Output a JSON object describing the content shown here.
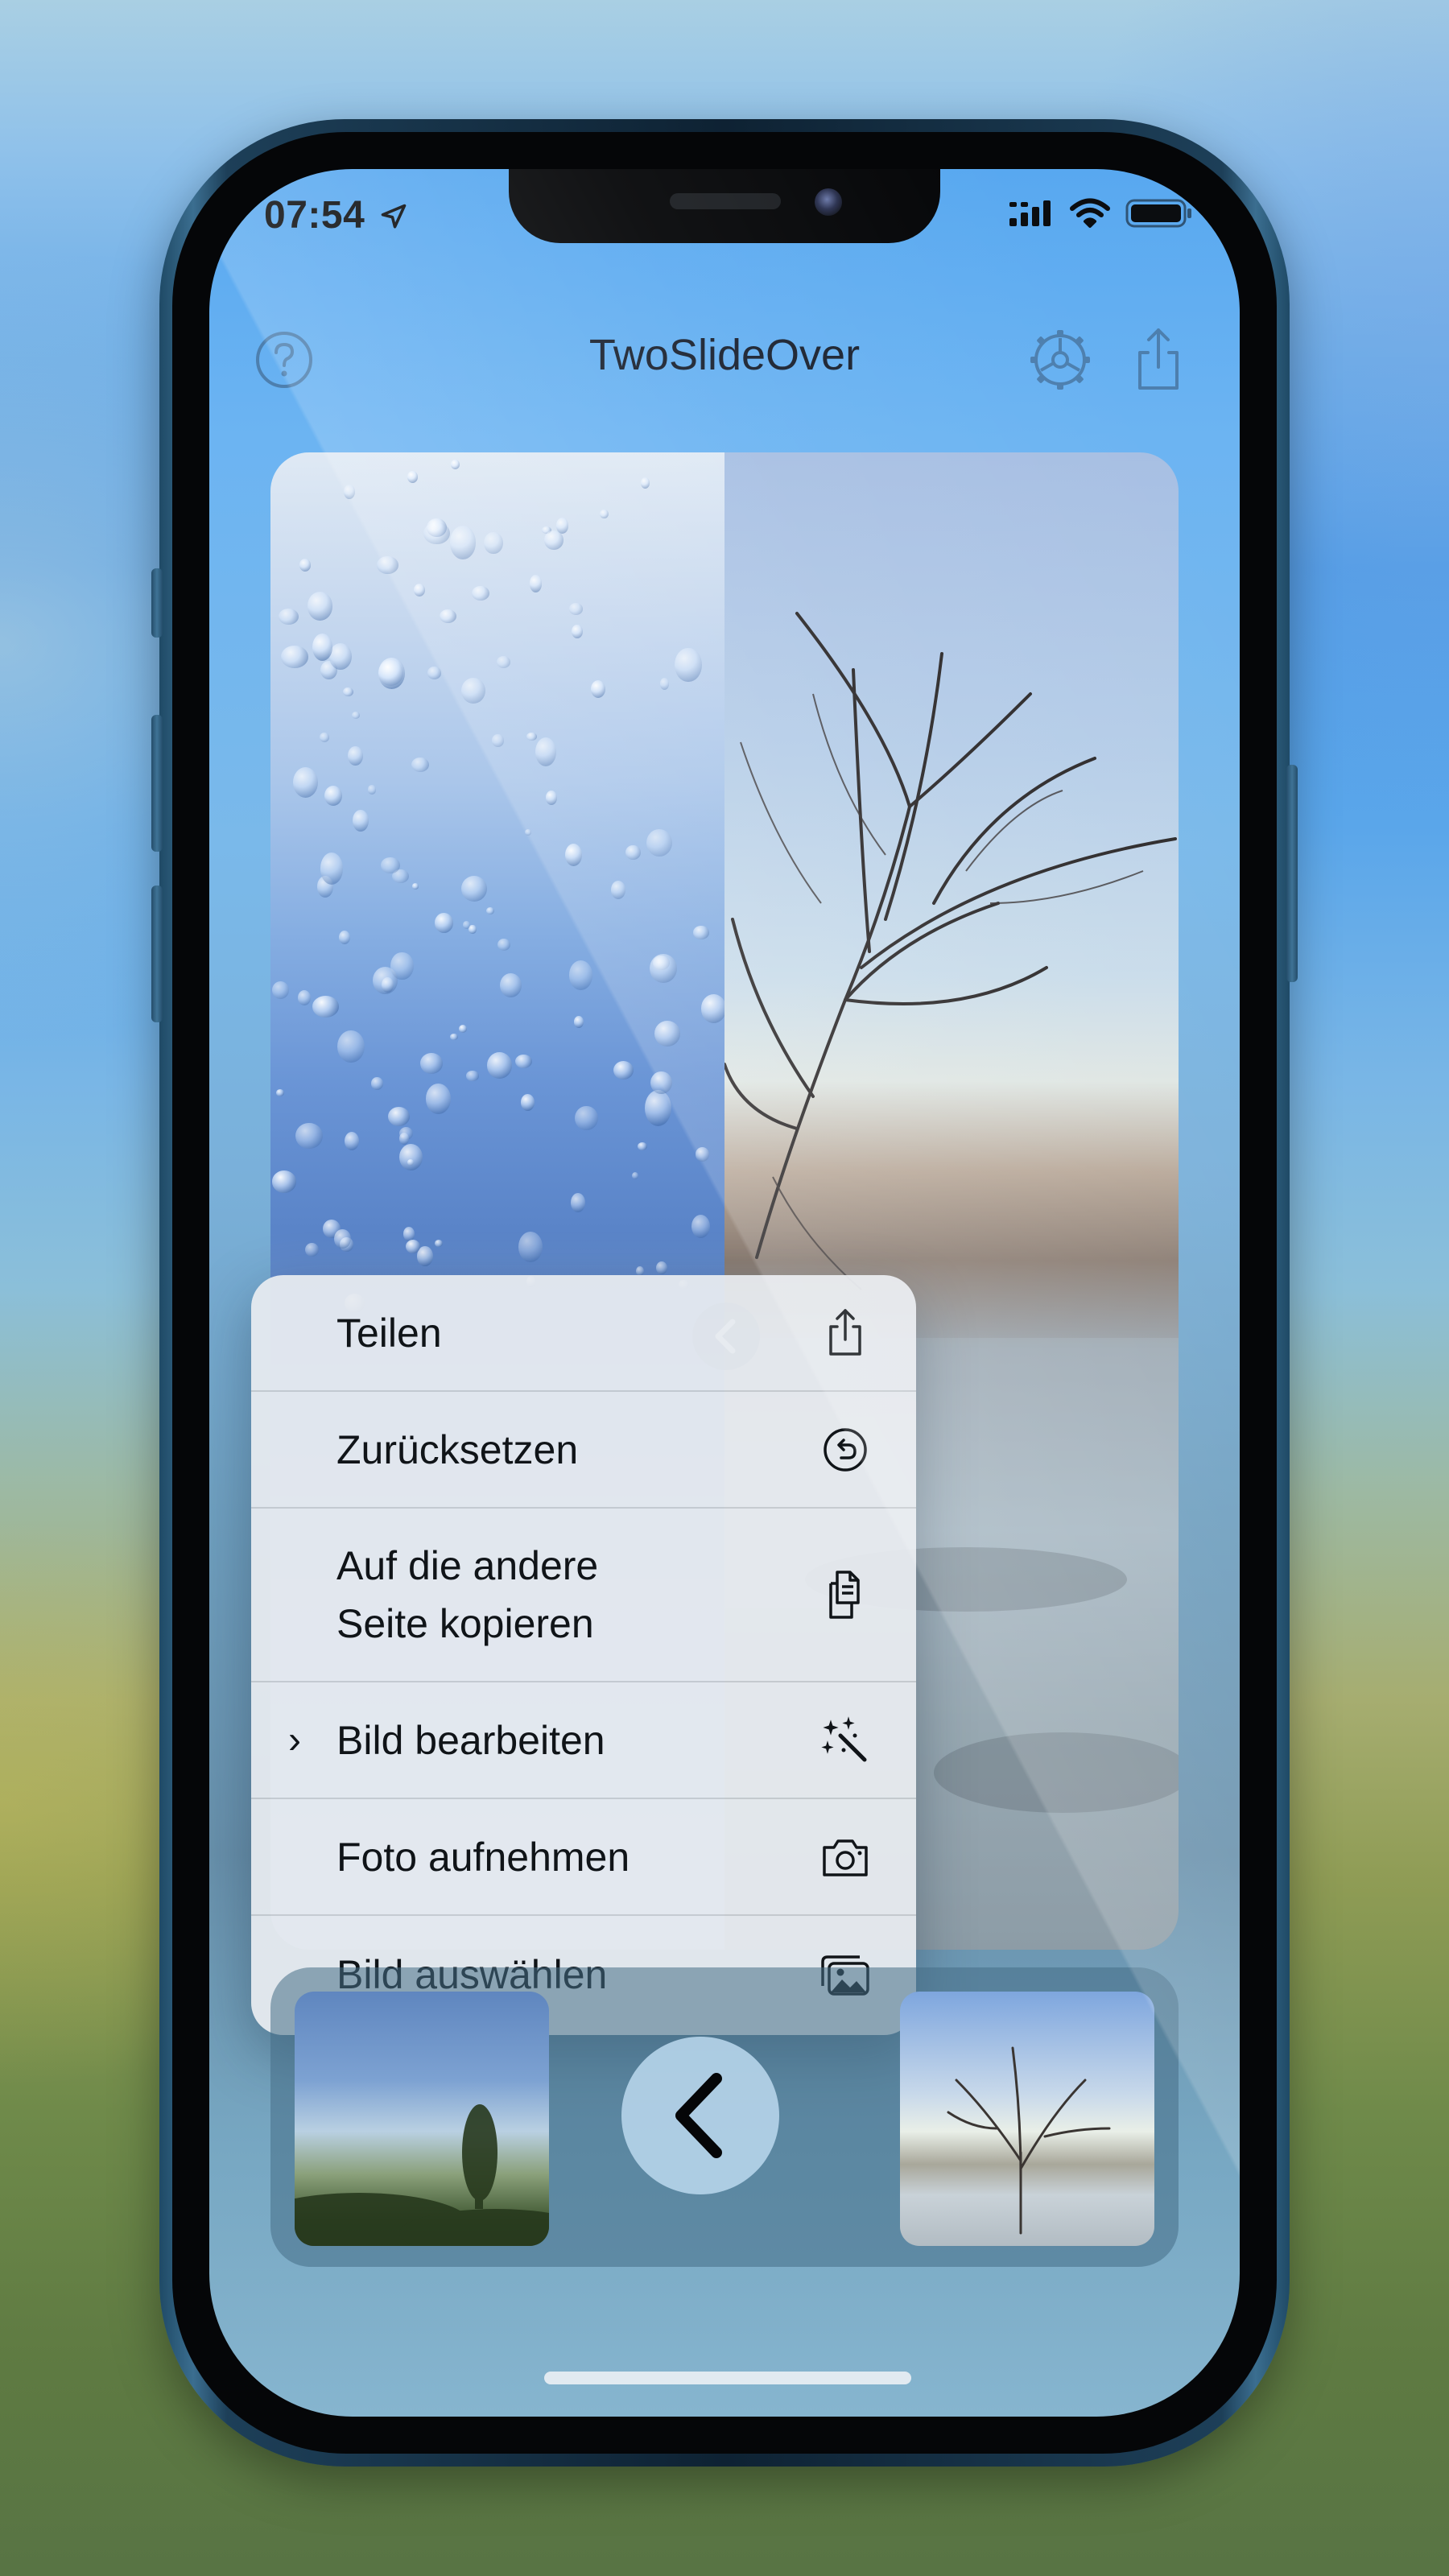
{
  "status_bar": {
    "time": "07:54"
  },
  "nav": {
    "title": "TwoSlideOver",
    "help_icon": "question-circle-icon",
    "settings_icon": "gear-icon",
    "share_icon": "share-icon"
  },
  "context_menu": {
    "items": [
      {
        "label": "Teilen",
        "icon": "share-icon",
        "submenu": false
      },
      {
        "label": "Zurücksetzen",
        "icon": "reset-arrow-circle-icon",
        "submenu": false
      },
      {
        "label": "Auf die andere\nSeite kopieren",
        "label_line1": "Auf die andere",
        "label_line2": "Seite kopieren",
        "icon": "copy-documents-icon",
        "submenu": false
      },
      {
        "label": "Bild bearbeiten",
        "icon": "magic-wand-icon",
        "submenu": true
      },
      {
        "label": "Foto aufnehmen",
        "icon": "camera-icon",
        "submenu": false
      },
      {
        "label": "Bild auswählen",
        "icon": "photo-library-icon",
        "submenu": false
      }
    ]
  },
  "colors": {
    "screen_top": "#58a8f0",
    "menu_bg": "#e8ecf0",
    "text": "#101418"
  }
}
